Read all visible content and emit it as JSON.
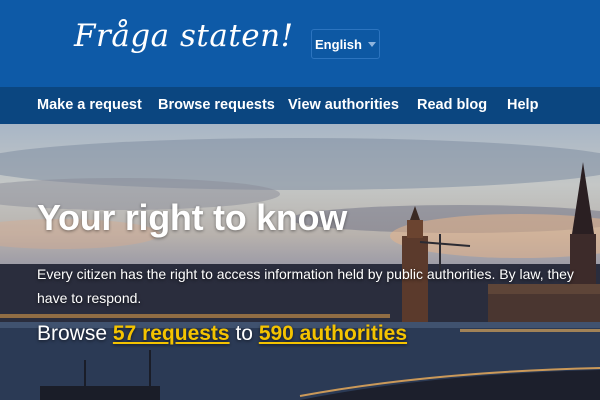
{
  "header": {
    "logo": "Fråga staten!",
    "language": "English"
  },
  "nav": {
    "items": [
      "Make a request",
      "Browse requests",
      "View authorities",
      "Read blog",
      "Help"
    ]
  },
  "hero": {
    "title": "Your right to know",
    "text": "Every citizen has the right to access information held by public authorities. By law, they have to respond.",
    "browse": {
      "prefix": "Browse",
      "requests": "57 requests",
      "connector": "to",
      "authorities": "590 authorities"
    }
  },
  "colors": {
    "header_bg": "#0e5aa7",
    "nav_bg": "#0b4680",
    "link_accent": "#f4c300"
  }
}
